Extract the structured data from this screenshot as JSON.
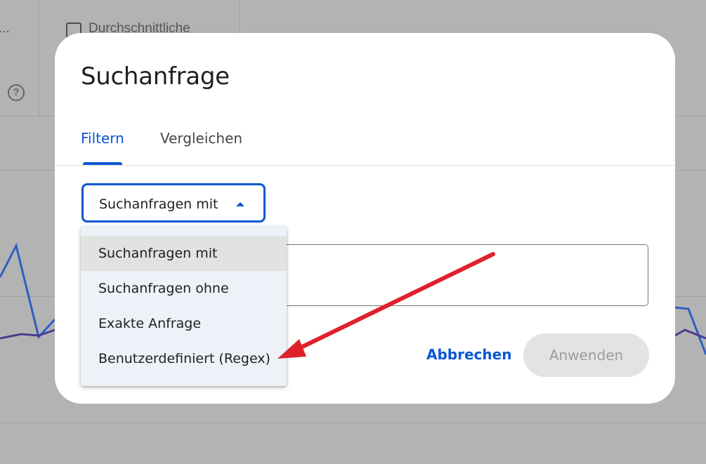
{
  "background": {
    "truncated_label": "...",
    "checkbox_label": "Durchschnittliche",
    "help_icon": "help-circle-icon"
  },
  "dialog": {
    "title": "Suchanfrage",
    "tabs": [
      {
        "label": "Filtern",
        "active": true
      },
      {
        "label": "Vergleichen",
        "active": false
      }
    ],
    "select": {
      "value": "Suchanfragen mit",
      "icon": "caret-up-icon"
    },
    "input_value": "",
    "cancel_label": "Abbrechen",
    "apply_label": "Anwenden"
  },
  "menu": {
    "items": [
      {
        "label": "Suchanfragen mit",
        "selected": true
      },
      {
        "label": "Suchanfragen ohne",
        "selected": false
      },
      {
        "label": "Exakte Anfrage",
        "selected": false
      },
      {
        "label": "Benutzerdefiniert (Regex)",
        "selected": false
      }
    ]
  },
  "colors": {
    "accent": "#0b57d0",
    "annotation_arrow": "#e0202a",
    "overlay": "#b3b3b3"
  }
}
